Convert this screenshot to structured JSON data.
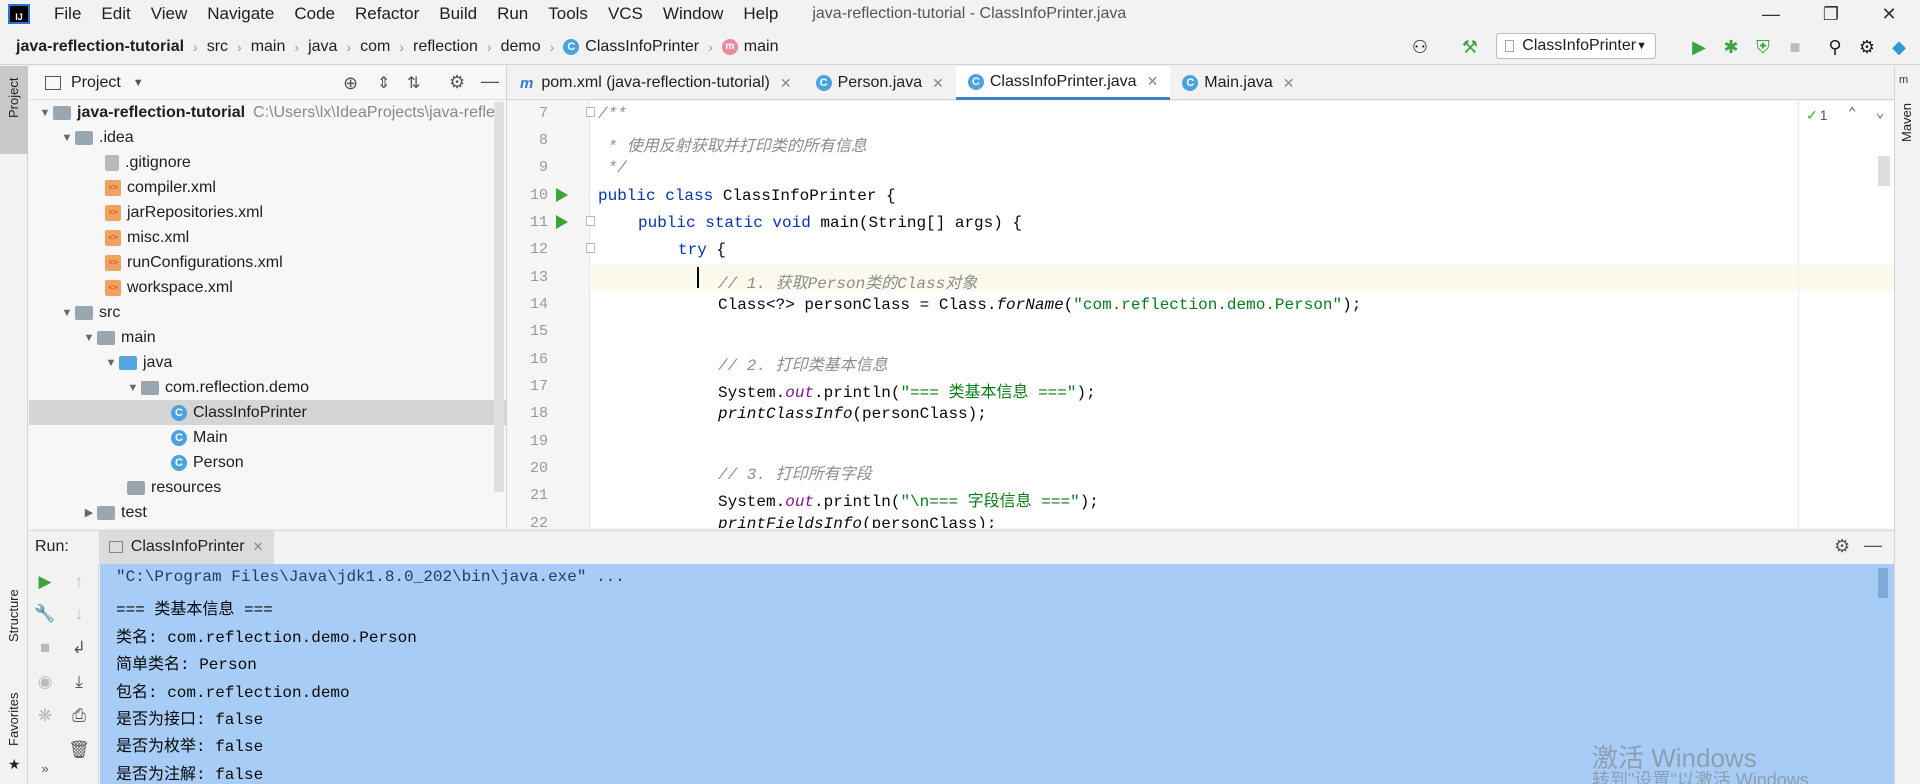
{
  "menubar": {
    "items": [
      "File",
      "Edit",
      "View",
      "Navigate",
      "Code",
      "Refactor",
      "Build",
      "Run",
      "Tools",
      "VCS",
      "Window",
      "Help"
    ],
    "window_title": "java-reflection-tutorial - ClassInfoPrinter.java"
  },
  "navbar": {
    "crumbs": [
      "java-reflection-tutorial",
      "src",
      "main",
      "java",
      "com",
      "reflection",
      "demo",
      "ClassInfoPrinter",
      "main"
    ],
    "run_config": "ClassInfoPrinter"
  },
  "project": {
    "title": "Project",
    "root_name": "java-reflection-tutorial",
    "root_path": "C:\\Users\\lx\\IdeaProjects\\java-refle",
    "tree": [
      ".idea",
      ".gitignore",
      "compiler.xml",
      "jarRepositories.xml",
      "misc.xml",
      "runConfigurations.xml",
      "workspace.xml",
      "src",
      "main",
      "java",
      "com.reflection.demo",
      "ClassInfoPrinter",
      "Main",
      "Person",
      "resources",
      "test"
    ]
  },
  "editor": {
    "tabs": [
      "pom.xml (java-reflection-tutorial)",
      "Person.java",
      "ClassInfoPrinter.java",
      "Main.java"
    ],
    "inspection_count": "1",
    "line_numbers": [
      "7",
      "8",
      "9",
      "10",
      "11",
      "12",
      "13",
      "14",
      "15",
      "16",
      "17",
      "18",
      "19",
      "20",
      "21",
      "22"
    ],
    "code": {
      "l7": "/**",
      "l8": " * 使用反射获取并打印类的所有信息",
      "l9": " */",
      "l10_kw": "public class",
      "l10_rest": " ClassInfoPrinter {",
      "l11_kw": "public static void",
      "l11_rest": " main(String[] args) {",
      "l12_kw": "try",
      "l12_rest": " {",
      "l13": "// 1. 获取Person类的Class对象",
      "l14_a": "Class<?> personClass = Class.",
      "l14_m": "forName",
      "l14_b": "(",
      "l14_s": "\"com.reflection.demo.Person\"",
      "l14_c": ");",
      "l16": "// 2. 打印类基本信息",
      "l17_a": "System.",
      "l17_f": "out",
      "l17_b": ".println(",
      "l17_s": "\"=== 类基本信息 ===\"",
      "l17_c": ");",
      "l18_m": "printClassInfo",
      "l18_rest": "(personClass);",
      "l20": "// 3. 打印所有字段",
      "l21_a": "System.",
      "l21_f": "out",
      "l21_b": ".println(",
      "l21_s": "\"\\n=== 字段信息 ===\"",
      "l21_c": ");",
      "l22_m": "printFieldsInfo",
      "l22_rest": "(personClass);"
    }
  },
  "run": {
    "label": "Run:",
    "tab": "ClassInfoPrinter",
    "console": [
      "\"C:\\Program Files\\Java\\jdk1.8.0_202\\bin\\java.exe\" ...",
      "=== 类基本信息 ===",
      "类名: com.reflection.demo.Person",
      "简单类名: Person",
      "包名: com.reflection.demo",
      "是否为接口: false",
      "是否为枚举: false",
      "是否为注解: false"
    ]
  },
  "side_stripes": {
    "left_top": "Project",
    "left_structure": "Structure",
    "left_favorites": "Favorites",
    "right_maven": "Maven"
  },
  "watermark": {
    "line1": "激活 Windows",
    "line2": "转到\"设置\"以激活 Windows"
  },
  "colors": {
    "accent": "#4083c9",
    "keyword": "#0033b3",
    "string": "#067d17",
    "comment": "#8c8c8c",
    "run_green": "#3aa53a",
    "console_selection": "#a7cdf6"
  }
}
